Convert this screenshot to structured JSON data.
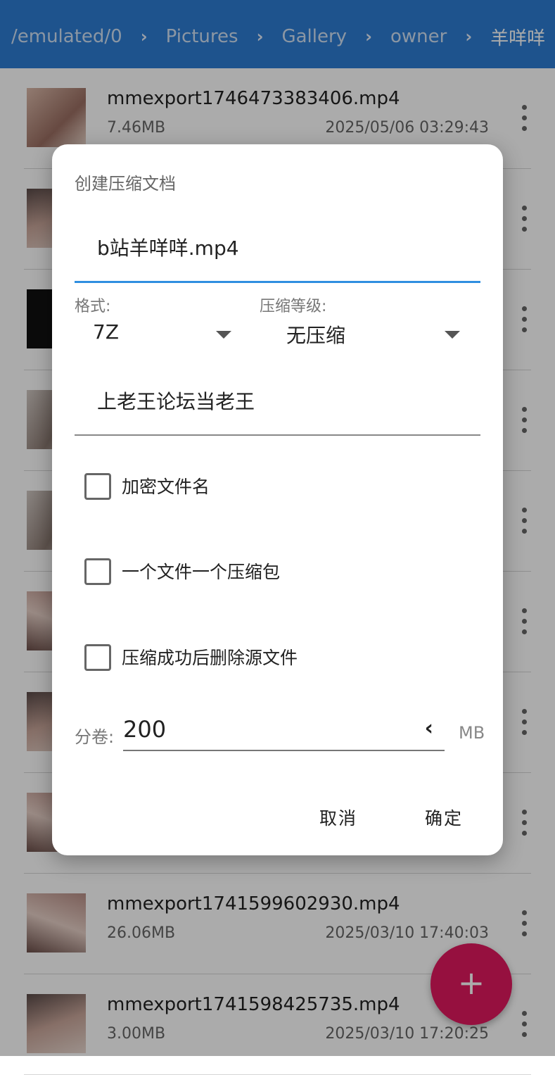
{
  "header": {
    "breadcrumbs": [
      "/emulated/0",
      "Pictures",
      "Gallery",
      "owner",
      "羊咩咩"
    ]
  },
  "files": [
    {
      "name": "mmexport1746473383406.mp4",
      "size": "7.46MB",
      "date": "2025/05/06 03:29:43"
    },
    {
      "name": "",
      "size": "",
      "date": ""
    },
    {
      "name": "",
      "size": "",
      "date": ""
    },
    {
      "name": "",
      "size": "",
      "date": ""
    },
    {
      "name": "",
      "size": "",
      "date": ""
    },
    {
      "name": "",
      "size": "",
      "date": ""
    },
    {
      "name": "",
      "size": "",
      "date": ""
    },
    {
      "name": "",
      "size": "",
      "date": ""
    },
    {
      "name": "mmexport1741599602930.mp4",
      "size": "26.06MB",
      "date": "2025/03/10 17:40:03"
    },
    {
      "name": "mmexport1741598425735.mp4",
      "size": "3.00MB",
      "date": "2025/03/10 17:20:25"
    }
  ],
  "fab": {
    "icon": "plus-icon",
    "label": "+"
  },
  "dialog": {
    "title": "创建压缩文档",
    "archive_name": "b站羊咩咩.mp4",
    "format_label": "格式:",
    "format_value": "7Z",
    "level_label": "压缩等级:",
    "level_value": "无压缩",
    "password_value": "上老王论坛当老王",
    "options": [
      {
        "label": "加密文件名",
        "checked": false
      },
      {
        "label": "一个文件一个压缩包",
        "checked": false
      },
      {
        "label": "压缩成功后删除源文件",
        "checked": false
      }
    ],
    "volume_label": "分卷:",
    "volume_value": "200",
    "volume_unit": "MB",
    "cancel_label": "取消",
    "confirm_label": "确定"
  },
  "colors": {
    "header": "#2d7cd3",
    "accent": "#2f8fe0",
    "fab": "#e0195f"
  }
}
